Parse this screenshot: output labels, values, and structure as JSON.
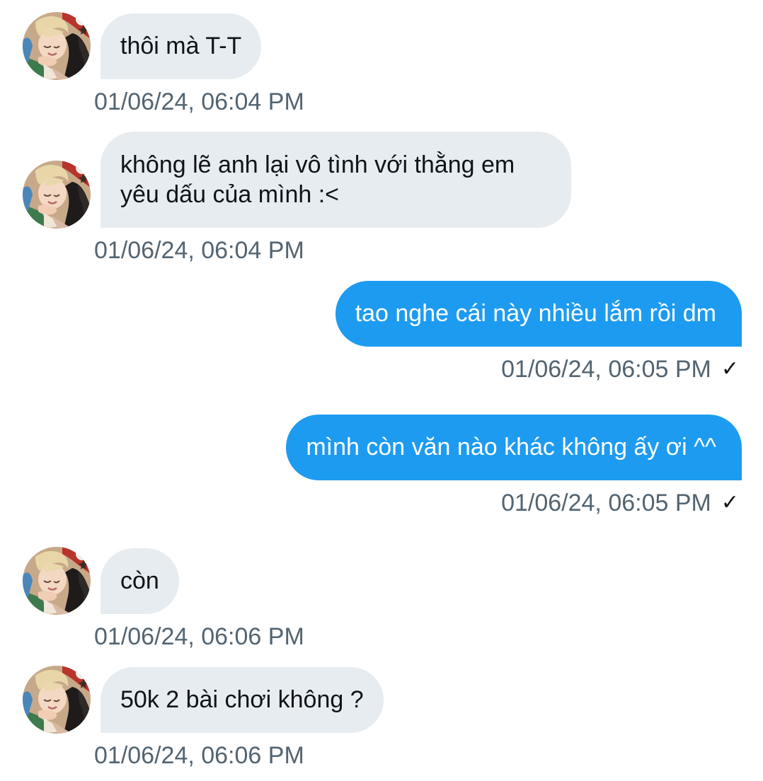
{
  "conversation": {
    "messages": [
      {
        "direction": "incoming",
        "avatar_icon": "contact-avatar-photo",
        "text": "thôi mà T-T",
        "timestamp": "01/06/24, 06:04 PM"
      },
      {
        "direction": "incoming",
        "avatar_icon": "contact-avatar-photo",
        "text_lines": [
          "không lẽ anh lại vô tình với thằng em",
          "yêu dấu của mình :<"
        ],
        "timestamp": "01/06/24, 06:04 PM"
      },
      {
        "direction": "outgoing",
        "text": "tao nghe cái này nhiều lắm rồi dm",
        "timestamp": "01/06/24, 06:05 PM",
        "status_icon": "check-icon",
        "status_glyph": "✓"
      },
      {
        "direction": "outgoing",
        "text": "mình còn văn nào khác không ấy ơi ^^",
        "timestamp": "01/06/24, 06:05 PM",
        "status_icon": "check-icon",
        "status_glyph": "✓"
      },
      {
        "direction": "incoming",
        "avatar_icon": "contact-avatar-photo",
        "text": "còn",
        "timestamp": "01/06/24, 06:06 PM"
      },
      {
        "direction": "incoming",
        "avatar_icon": "contact-avatar-photo",
        "text": "50k 2 bài chơi không ?",
        "timestamp": "01/06/24, 06:06 PM"
      }
    ]
  },
  "colors": {
    "incoming_bubble": "#e7ecf0",
    "outgoing_bubble": "#1d9bf0",
    "timestamp_text": "#536471",
    "message_text": "#0f1419"
  }
}
